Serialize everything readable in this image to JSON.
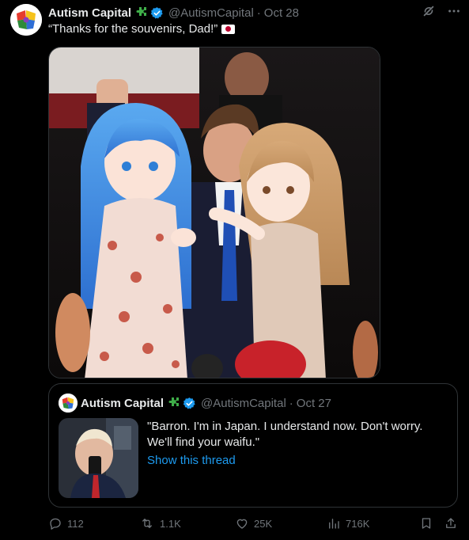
{
  "tweet": {
    "author_name": "Autism Capital",
    "handle": "@AutismCapital",
    "date": "Oct 28",
    "text": "“Thanks for the souvenirs, Dad!”",
    "flag_icon": "japan-flag-icon"
  },
  "quoted_tweet": {
    "author_name": "Autism Capital",
    "handle": "@AutismCapital",
    "date": "Oct 27",
    "text": "\"Barron. I'm in Japan. I understand now. Don't worry. We'll find your waifu.\"",
    "link_text": "Show this thread"
  },
  "actions": {
    "replies": "112",
    "reposts": "1.1K",
    "likes": "25K",
    "views": "716K"
  },
  "colors": {
    "background": "#000000",
    "text": "#e7e9ea",
    "muted": "#71767b",
    "link": "#1d9bf0",
    "border": "#2f3336",
    "verified": "#1d9bf0",
    "puzzle_badge": "#3fae49"
  },
  "icons": [
    "grok-icon",
    "more-icon",
    "verified-badge-icon",
    "puzzle-badge-icon",
    "reply-icon",
    "repost-icon",
    "like-icon",
    "views-icon",
    "bookmark-icon",
    "share-icon"
  ]
}
